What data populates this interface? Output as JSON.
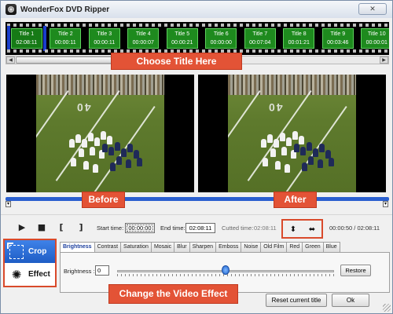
{
  "window": {
    "title": "WonderFox DVD Ripper",
    "close_glyph": "✕"
  },
  "titles": [
    {
      "name": "Title 1",
      "time": "02:08:11",
      "selected": true
    },
    {
      "name": "Title 2",
      "time": "00:00:11"
    },
    {
      "name": "Title 3",
      "time": "00:00:11"
    },
    {
      "name": "Title 4",
      "time": "00:00:07"
    },
    {
      "name": "Title 5",
      "time": "00:00:21"
    },
    {
      "name": "Title 6",
      "time": "00:00:00"
    },
    {
      "name": "Title 7",
      "time": "00:07:04"
    },
    {
      "name": "Title 8",
      "time": "00:01:21"
    },
    {
      "name": "Title 9",
      "time": "00:03:46"
    },
    {
      "name": "Title 10",
      "time": "00:00:01"
    }
  ],
  "callouts": {
    "choose": "Choose Title Here",
    "before": "Before",
    "after": "After",
    "change": "Change the Video Effect"
  },
  "preview": {
    "yard_number": "40"
  },
  "playback": {
    "start_label": "Start time:",
    "start_value": "00:00:00",
    "end_label": "End time:",
    "end_value": "02:08:11",
    "cut_label": "Cutted time:",
    "cut_value": "02:08:11",
    "progress": "00:00:50 / 02:08:11"
  },
  "sidebar": {
    "crop": "Crop",
    "effect": "Effect"
  },
  "effects": {
    "tabs": [
      "Brightness",
      "Contrast",
      "Saturation",
      "Mosaic",
      "Blur",
      "Sharpen",
      "Emboss",
      "Noise",
      "Old Film",
      "Red",
      "Green",
      "Blue"
    ],
    "active": "Brightness",
    "brightness_label": "Brightness :",
    "brightness_value": "0",
    "slider_level": 0.5,
    "restore": "Restore"
  },
  "footer": {
    "reset": "Reset current title",
    "ok": "Ok"
  },
  "colors": {
    "callout": "#e35336",
    "title_box": "#1e8a1e",
    "seek": "#2a5fcf"
  }
}
